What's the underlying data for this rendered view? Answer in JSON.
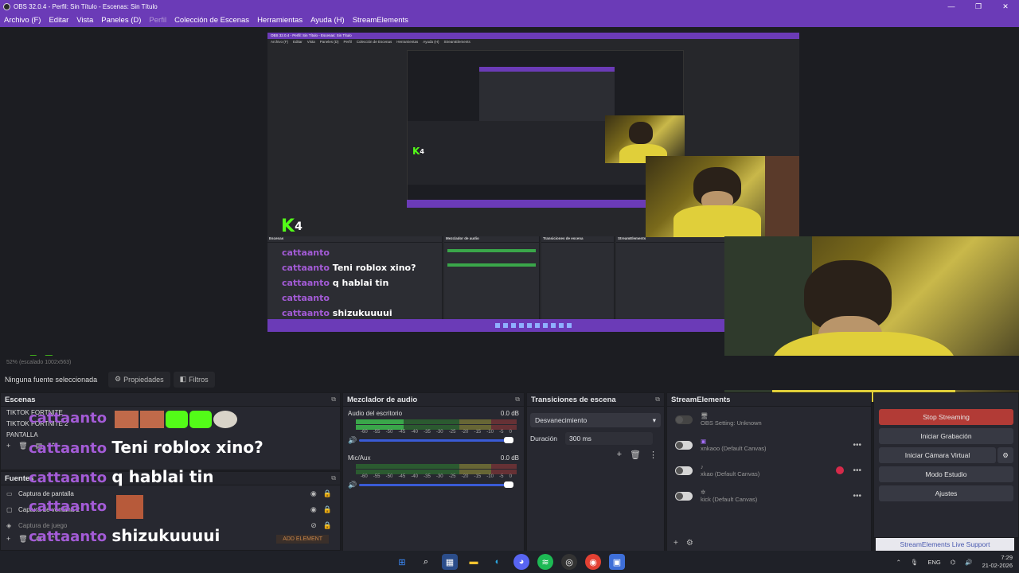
{
  "window": {
    "title": "OBS 32.0.4 - Perfil: Sin Título - Escenas: Sin Título"
  },
  "menu": [
    "Archivo (F)",
    "Editar",
    "Vista",
    "Paneles (D)",
    "Perfil",
    "Colección de Escenas",
    "Herramientas",
    "Ayuda (H)",
    "StreamElements"
  ],
  "status": {
    "scale": "52% (escalado 1002x563)"
  },
  "context": {
    "no_selection": "Ninguna fuente seleccionada",
    "properties": "Propiedades",
    "filters": "Filtros"
  },
  "scenes": {
    "title": "Escenas",
    "items": [
      "TIKTOK FORTNITE",
      "TIKTOK FORTNITE 2",
      "PANTALLA"
    ]
  },
  "sources": {
    "title": "Fuentes",
    "items": [
      {
        "label": "Captura de pantalla",
        "icon": "monitor-icon"
      },
      {
        "label": "Captura de ventana 2",
        "icon": "window-icon"
      },
      {
        "label": "Captura de juego",
        "icon": "gamepad-icon"
      }
    ],
    "add_element": "ADD ELEMENT"
  },
  "mixer": {
    "title": "Mezclador de audio",
    "channels": [
      {
        "name": "Audio del escritorio",
        "db": "0.0 dB",
        "level": 0.35
      },
      {
        "name": "Mic/Aux",
        "db": "0.0 dB",
        "level": 0.0
      }
    ],
    "scale": [
      "-60",
      "-55",
      "-50",
      "-45",
      "-40",
      "-35",
      "-30",
      "-25",
      "-20",
      "-15",
      "-10",
      "-5",
      "0"
    ]
  },
  "transitions": {
    "title": "Transiciones de escena",
    "selected": "Desvanecimiento",
    "duration_label": "Duración",
    "duration_value": "300 ms"
  },
  "streamelements": {
    "title": "StreamElements",
    "rows": [
      {
        "label": "OBS Setting: Unknown",
        "sub": ""
      },
      {
        "label": "xnkaoo (Default Canvas)",
        "sub": ""
      },
      {
        "label": "xkao (Default Canvas)",
        "sub": ""
      },
      {
        "label": "kick (Default Canvas)",
        "sub": ""
      }
    ]
  },
  "controls": {
    "stop_streaming": "Stop Streaming",
    "start_recording": "Iniciar Grabación",
    "virtual_cam": "Iniciar Cámara Virtual",
    "studio_mode": "Modo Estudio",
    "settings": "Ajustes",
    "support": "StreamElements Live Support"
  },
  "overlay": {
    "kick_number": "4",
    "chat": [
      {
        "user": "cattaanto",
        "msg": ""
      },
      {
        "user": "cattaanto",
        "msg": "Teni roblox xino?"
      },
      {
        "user": "cattaanto",
        "msg": "q hablai tin"
      },
      {
        "user": "cattaanto",
        "msg": ""
      },
      {
        "user": "cattaanto",
        "msg": "shizukuuuui"
      }
    ]
  },
  "system": {
    "lang": "ENG",
    "time": "7:29",
    "date": "21-02-2026"
  },
  "colors": {
    "accent": "#6b3bb7",
    "kick_green": "#53fc18",
    "chat_name": "#a35bd6",
    "stop": "#b23b36"
  }
}
